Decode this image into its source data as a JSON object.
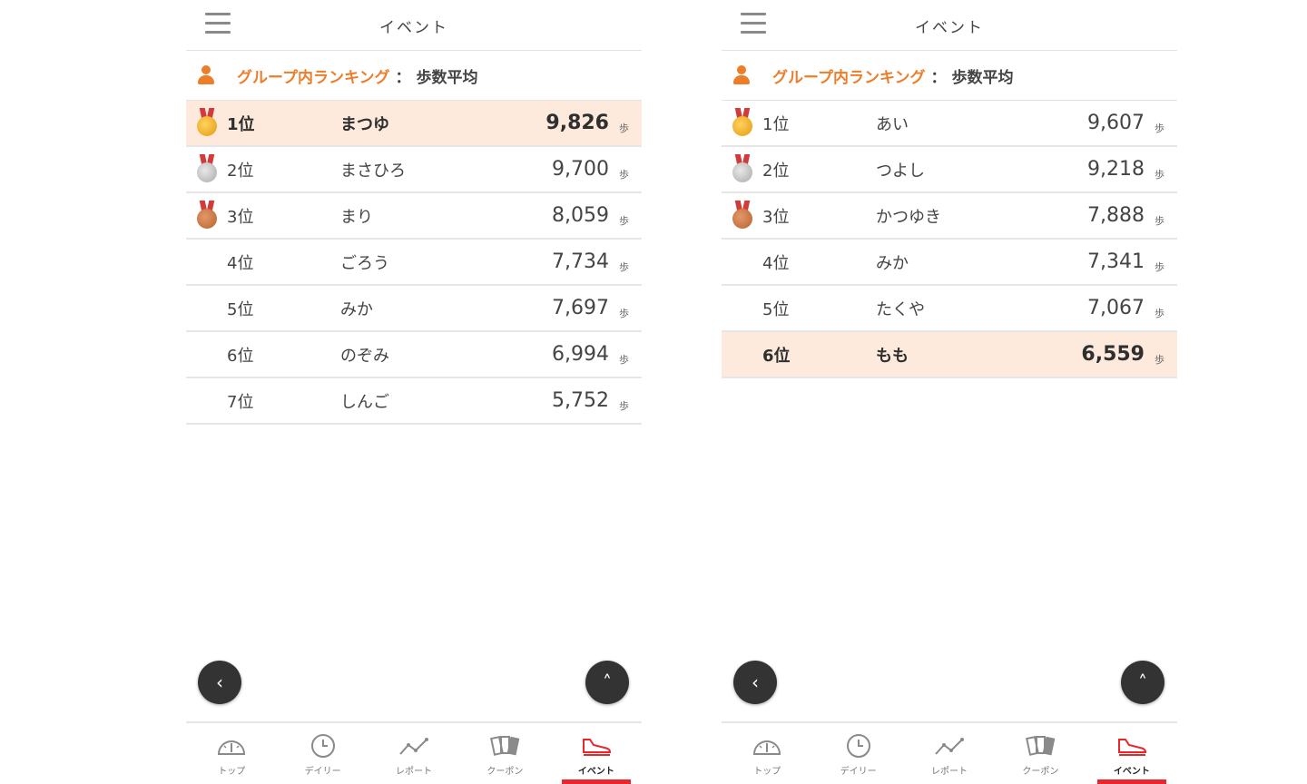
{
  "header": {
    "title": "イベント"
  },
  "section": {
    "label": "グループ内ランキング",
    "separator": "：",
    "metric": "歩数平均"
  },
  "unit": "歩",
  "screens": [
    {
      "rankings": [
        {
          "rank": "1位",
          "name": "まつゆ",
          "steps": "9,826",
          "medal": "gold",
          "highlight": true
        },
        {
          "rank": "2位",
          "name": "まさひろ",
          "steps": "9,700",
          "medal": "silver",
          "highlight": false
        },
        {
          "rank": "3位",
          "name": "まり",
          "steps": "8,059",
          "medal": "bronze",
          "highlight": false
        },
        {
          "rank": "4位",
          "name": "ごろう",
          "steps": "7,734",
          "medal": null,
          "highlight": false
        },
        {
          "rank": "5位",
          "name": "みか",
          "steps": "7,697",
          "medal": null,
          "highlight": false
        },
        {
          "rank": "6位",
          "name": "のぞみ",
          "steps": "6,994",
          "medal": null,
          "highlight": false
        },
        {
          "rank": "7位",
          "name": "しんご",
          "steps": "5,752",
          "medal": null,
          "highlight": false
        }
      ]
    },
    {
      "rankings": [
        {
          "rank": "1位",
          "name": "あい",
          "steps": "9,607",
          "medal": "gold",
          "highlight": false
        },
        {
          "rank": "2位",
          "name": "つよし",
          "steps": "9,218",
          "medal": "silver",
          "highlight": false
        },
        {
          "rank": "3位",
          "name": "かつゆき",
          "steps": "7,888",
          "medal": "bronze",
          "highlight": false
        },
        {
          "rank": "4位",
          "name": "みか",
          "steps": "7,341",
          "medal": null,
          "highlight": false
        },
        {
          "rank": "5位",
          "name": "たくや",
          "steps": "7,067",
          "medal": null,
          "highlight": false
        },
        {
          "rank": "6位",
          "name": "もも",
          "steps": "6,559",
          "medal": null,
          "highlight": true
        }
      ]
    }
  ],
  "fab": {
    "back_icon": "‹",
    "top_icon": "˄"
  },
  "tabs": [
    {
      "label": "トップ",
      "icon": "speedometer-icon",
      "active": false
    },
    {
      "label": "デイリー",
      "icon": "clock-icon",
      "active": false
    },
    {
      "label": "レポート",
      "icon": "line-chart-icon",
      "active": false
    },
    {
      "label": "クーポン",
      "icon": "coupon-cards-icon",
      "active": false
    },
    {
      "label": "イベント",
      "icon": "sneaker-icon",
      "active": true
    }
  ],
  "colors": {
    "accent": "#ee7d2a",
    "highlight_row": "#fdeadc",
    "active_tab": "#e8262b",
    "fab": "#333333"
  }
}
